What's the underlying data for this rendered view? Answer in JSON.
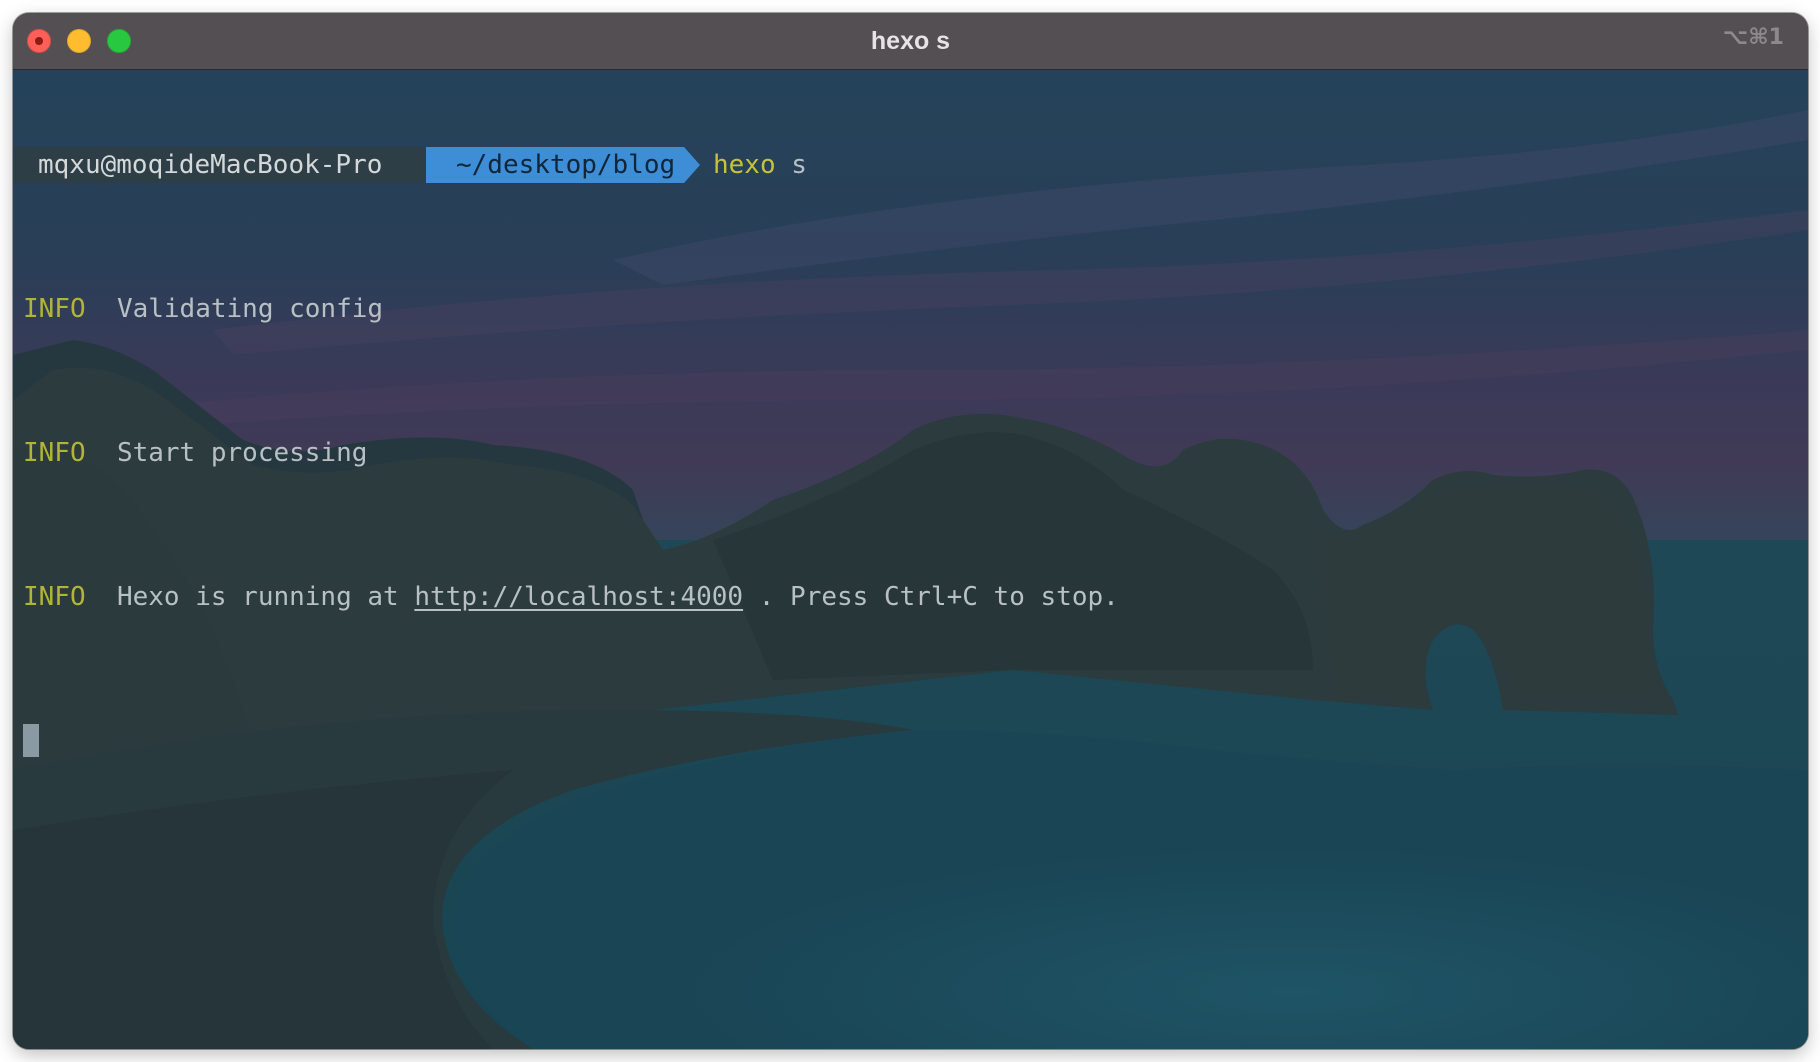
{
  "window": {
    "title": "hexo s",
    "shortcut": "⌥⌘1"
  },
  "prompt": {
    "user_host": "mqxu@moqideMacBook-Pro",
    "path": "~/desktop/blog",
    "command": "hexo",
    "argument": "s"
  },
  "output": [
    {
      "level": "INFO",
      "message": "Validating config"
    },
    {
      "level": "INFO",
      "message": "Start processing"
    },
    {
      "level": "INFO",
      "message_before": "Hexo is running at ",
      "link": "http://localhost:4000",
      "message_after": " . Press Ctrl+C to stop."
    }
  ],
  "colors": {
    "titlebar": "#544f53",
    "prompt_user_bg": "#2e3e46",
    "prompt_path_bg": "#3d8ed6",
    "command": "#c6c23a",
    "info_level": "#b2b436",
    "text": "#b8c0c4"
  }
}
